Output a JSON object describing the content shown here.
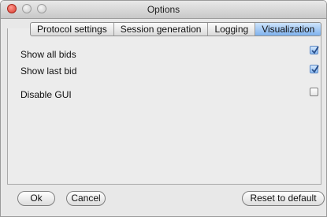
{
  "window": {
    "title": "Options"
  },
  "tabs": [
    {
      "label": "Protocol settings",
      "active": false
    },
    {
      "label": "Session generation",
      "active": false
    },
    {
      "label": "Logging",
      "active": false
    },
    {
      "label": "Visualization",
      "active": true
    }
  ],
  "options": [
    {
      "label": "Show all bids",
      "checked": true
    },
    {
      "label": "Show last bid",
      "checked": true
    },
    {
      "label": "Disable GUI",
      "checked": false
    }
  ],
  "buttons": {
    "ok": "Ok",
    "cancel": "Cancel",
    "reset": "Reset to default"
  },
  "colors": {
    "active_tab": "#7fb2ee",
    "close_button": "#d8392d",
    "check_accent": "#2a4f8a"
  }
}
